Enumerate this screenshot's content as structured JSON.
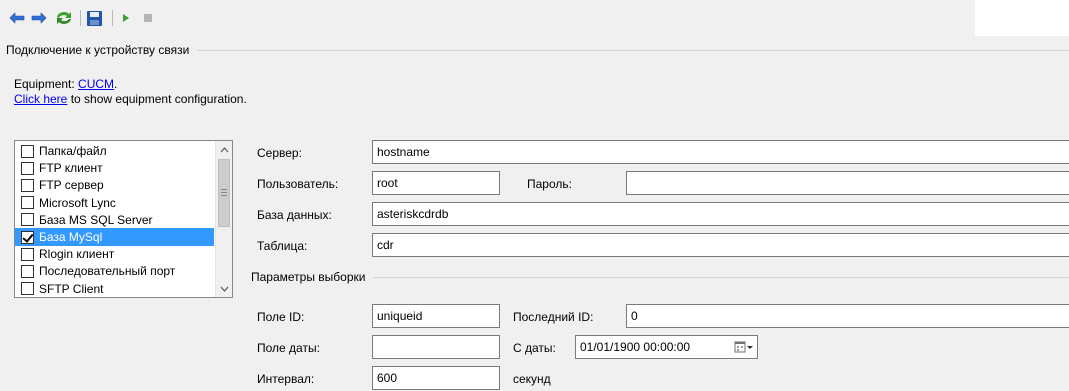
{
  "toolbar": {
    "icons": [
      "back-arrow-icon",
      "forward-arrow-icon",
      "refresh-icon",
      "save-icon",
      "play-icon",
      "stop-icon"
    ]
  },
  "connection_group": {
    "title": "Подключение к устройству связи",
    "equipment_label": "Equipment:",
    "equipment_link": "CUCM",
    "equipment_suffix": ".",
    "click_here_link": "Click here",
    "click_here_suffix": "to show equipment configuration."
  },
  "connection_types": {
    "items": [
      {
        "label": "Папка/файл",
        "checked": false,
        "selected": false
      },
      {
        "label": "FTP клиент",
        "checked": false,
        "selected": false
      },
      {
        "label": "FTP сервер",
        "checked": false,
        "selected": false
      },
      {
        "label": "Microsoft Lync",
        "checked": false,
        "selected": false
      },
      {
        "label": "База MS SQL Server",
        "checked": false,
        "selected": false
      },
      {
        "label": "База MySql",
        "checked": true,
        "selected": true
      },
      {
        "label": "Rlogin клиент",
        "checked": false,
        "selected": false
      },
      {
        "label": "Последовательный порт",
        "checked": false,
        "selected": false
      },
      {
        "label": "SFTP Client",
        "checked": false,
        "selected": false
      }
    ]
  },
  "db_settings": {
    "server_label": "Сервер:",
    "server_value": "hostname",
    "user_label": "Пользователь:",
    "user_value": "root",
    "password_label": "Пароль:",
    "password_value": "",
    "database_label": "База данных:",
    "database_value": "asteriskcdrdb",
    "table_label": "Таблица:",
    "table_value": "cdr"
  },
  "selection_params": {
    "title": "Параметры выборки",
    "id_field_label": "Поле ID:",
    "id_field_value": "uniqueid",
    "last_id_label": "Последний ID:",
    "last_id_value": "0",
    "date_field_label": "Поле даты:",
    "date_field_value": "",
    "from_date_label": "С даты:",
    "from_date_value": "01/01/1900 00:00:00",
    "interval_label": "Интервал:",
    "interval_value": "600",
    "interval_unit": "секунд"
  },
  "colors": {
    "selection": "#3399ff",
    "link": "#0000ee",
    "arrow_blue": "#2f6fd6",
    "refresh_green": "#3aa12e"
  }
}
